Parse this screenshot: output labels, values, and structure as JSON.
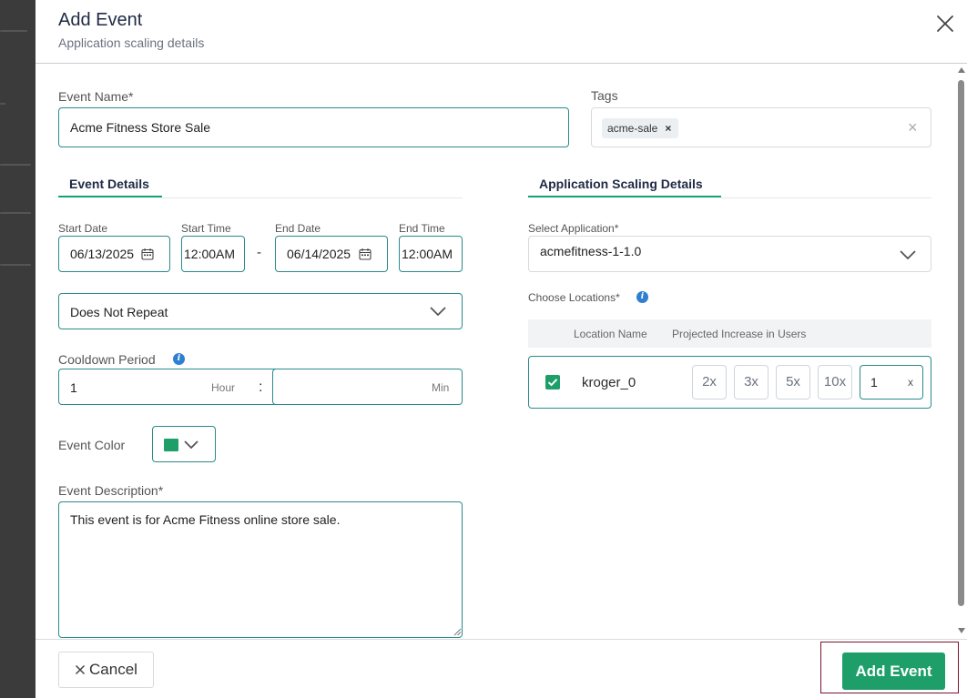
{
  "modal": {
    "title": "Add Event",
    "subtitle": "Application scaling details"
  },
  "event_name": {
    "label": "Event Name*",
    "value": "Acme Fitness Store Sale"
  },
  "tags": {
    "label": "Tags",
    "items": [
      {
        "label": "acme-sale"
      }
    ],
    "clear_label": "×"
  },
  "event_details": {
    "tab_label": "Event Details",
    "start_date": {
      "label": "Start Date",
      "value": "06/13/2025"
    },
    "start_time": {
      "label": "Start Time",
      "value": "12:00AM"
    },
    "separator": "-",
    "end_date": {
      "label": "End Date",
      "value": "06/14/2025"
    },
    "end_time": {
      "label": "End Time",
      "value": "12:00AM"
    },
    "repeat": {
      "value": "Does Not Repeat"
    },
    "cooldown": {
      "label": "Cooldown Period",
      "hour_value": "1",
      "hour_unit": "Hour",
      "colon": ":",
      "min_value": "",
      "min_unit": "Min"
    },
    "event_color": {
      "label": "Event Color",
      "value": "#1e9f6a"
    },
    "description": {
      "label": "Event Description*",
      "value": "This event is for Acme Fitness online store sale."
    }
  },
  "scaling": {
    "tab_label": "Application Scaling Details",
    "select_application": {
      "label": "Select Application*",
      "value": "acmefitness-1-1.0"
    },
    "choose_locations": {
      "label": "Choose Locations*"
    },
    "table_headers": {
      "location_name": "Location Name",
      "projected_increase": "Projected Increase in Users"
    },
    "locations": [
      {
        "name": "kroger_0",
        "checked": true,
        "multipliers": [
          "2x",
          "3x",
          "5x",
          "10x"
        ],
        "custom_value": "1",
        "custom_clear": "x"
      }
    ]
  },
  "footer": {
    "cancel_label": "Cancel",
    "add_label": "Add Event"
  },
  "colors": {
    "accent": "#1e9f6a",
    "field_border": "#2b8a8a",
    "info": "#2f7fd1",
    "title": "#1f2a44"
  }
}
